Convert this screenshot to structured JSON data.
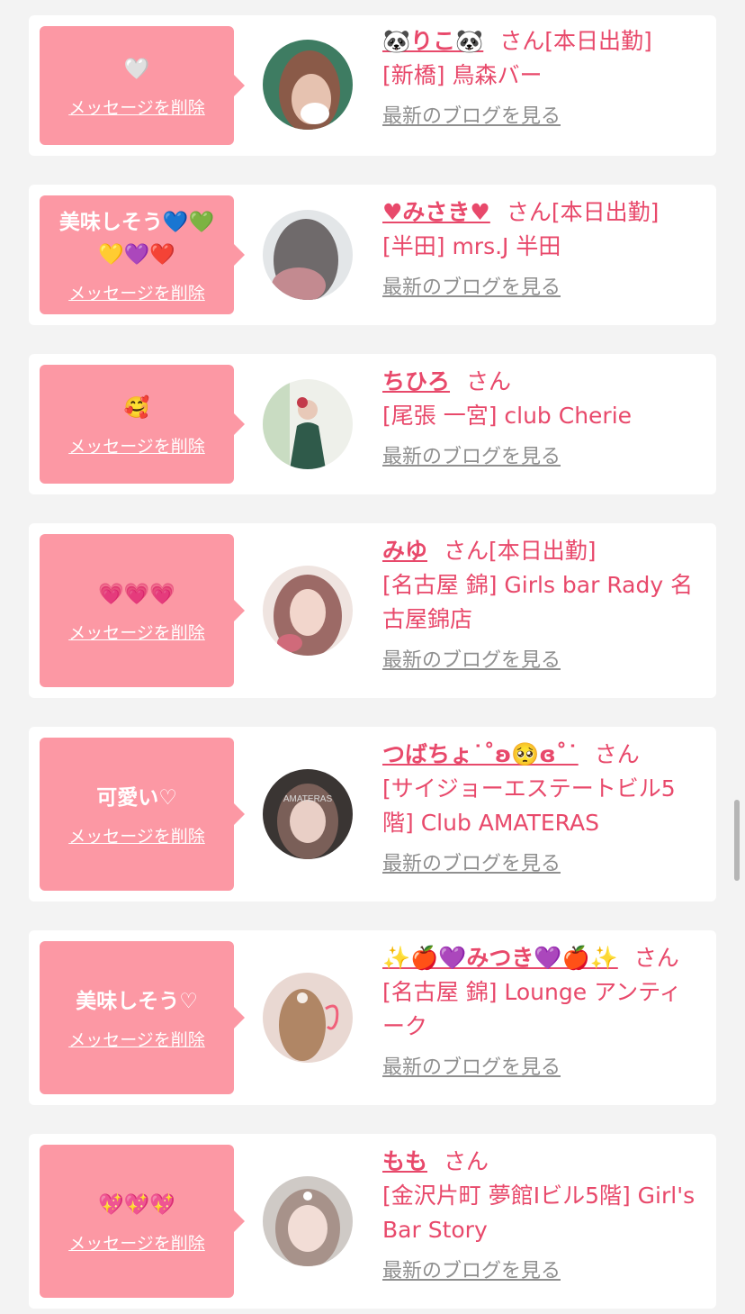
{
  "messages": [
    {
      "message": "🤍",
      "delete_label": "メッセージを削除",
      "name": "🐼りこ🐼",
      "suffix": "さん[本日出勤]",
      "shop": "[新橋] 鳥森バー",
      "blog_label": "最新のブログを見る"
    },
    {
      "message": "美味しそう💙💚\n💛💜❤️",
      "delete_label": "メッセージを削除",
      "name": "♥みさき♥",
      "suffix": "さん[本日出勤]",
      "shop": "[半田] mrs.J 半田",
      "blog_label": "最新のブログを見る"
    },
    {
      "message": "🥰",
      "delete_label": "メッセージを削除",
      "name": "ちひろ",
      "suffix": "さん",
      "shop": "[尾張 一宮] club Cherie",
      "blog_label": "最新のブログを見る"
    },
    {
      "message": "💗💗💗",
      "delete_label": "メッセージを削除",
      "name": "みゆ",
      "suffix": "さん[本日出勤]",
      "shop": "[名古屋 錦] Girls bar Rady 名古屋錦店",
      "blog_label": "最新のブログを見る"
    },
    {
      "message": "可愛い♡",
      "delete_label": "メッセージを削除",
      "name": "つばちょ˙˚ʚ🥺ɞ˚˙",
      "suffix": "さん",
      "shop": "[サイジョーエステートビル5階] Club AMATERAS",
      "blog_label": "最新のブログを見る"
    },
    {
      "message": "美味しそう♡",
      "delete_label": "メッセージを削除",
      "name": "✨🍎💜みつき💜🍎✨",
      "suffix": "さん",
      "shop": "[名古屋 錦] Lounge アンティーク",
      "blog_label": "最新のブログを見る"
    },
    {
      "message": "💖💖💖",
      "delete_label": "メッセージを削除",
      "name": "もも",
      "suffix": "さん",
      "shop": "[金沢片町 夢館Ⅰビル5階] Girl's Bar Story",
      "blog_label": "最新のブログを見る"
    }
  ],
  "colors": {
    "accent": "#e8496b",
    "bubble": "#fc98a4",
    "link_gray": "#8f8f8f",
    "background": "#f3f3f3"
  }
}
